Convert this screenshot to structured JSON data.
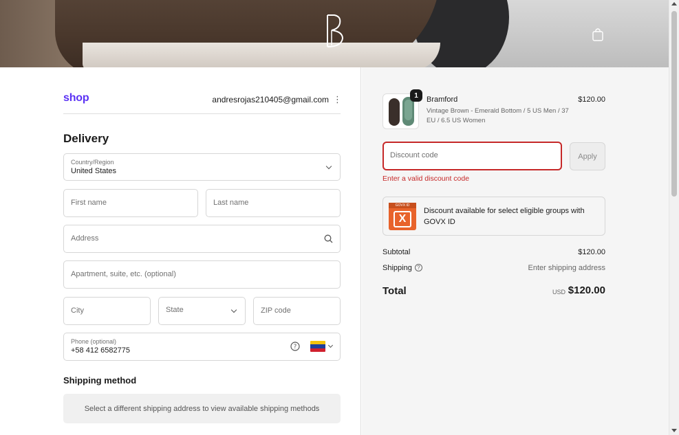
{
  "header": {
    "brand_logo_icon": "brand-b-logo-icon",
    "bag_icon": "shopping-bag-icon"
  },
  "account": {
    "shop_logo": "shop",
    "email": "andresrojas210405@gmail.com",
    "menu_icon": "kebab-menu-icon"
  },
  "delivery": {
    "title": "Delivery",
    "country_label": "Country/Region",
    "country_value": "United States",
    "first_name_placeholder": "First name",
    "last_name_placeholder": "Last name",
    "address_placeholder": "Address",
    "apartment_placeholder": "Apartment, suite, etc. (optional)",
    "city_placeholder": "City",
    "state_placeholder": "State",
    "zip_placeholder": "ZIP code",
    "phone_label": "Phone (optional)",
    "phone_value": "+58 412 6582775"
  },
  "shipping_method": {
    "title": "Shipping method",
    "message": "Select a different shipping address to view available shipping methods"
  },
  "order": {
    "quantity_badge": "1",
    "product_name": "Bramford",
    "product_variant": "Vintage Brown - Emerald Bottom / 5 US Men / 37 EU / 6.5 US Women",
    "product_price": "$120.00",
    "discount_placeholder": "Discount code",
    "apply_label": "Apply",
    "discount_error": "Enter a valid discount code",
    "govx_logo_top": "GOVX ID",
    "govx_logo_mark": "X",
    "govx_text": "Discount available for select eligible groups with GOVX ID",
    "subtotal_label": "Subtotal",
    "subtotal_value": "$120.00",
    "shipping_label": "Shipping",
    "shipping_value": "Enter shipping address",
    "total_label": "Total",
    "total_currency": "USD",
    "total_value": "$120.00"
  },
  "colors": {
    "shop_brand": "#5a31f4",
    "error": "#c62828",
    "govx_orange": "#e8632b"
  }
}
